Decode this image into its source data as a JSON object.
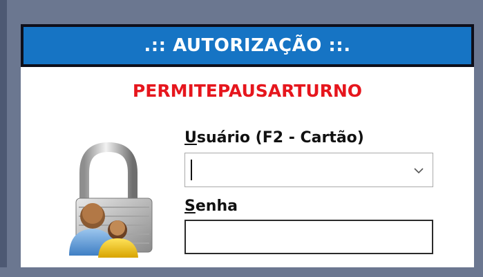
{
  "dialog": {
    "title": ".:: AUTORIZAÇÃO ::.",
    "permission": "PERMITEPAUSARTURNO",
    "user_field": {
      "label_underlined": "U",
      "label_rest": "suário (F2 - Cartão)",
      "value": ""
    },
    "password_field": {
      "label_underlined": "S",
      "label_rest": "enha",
      "value": ""
    }
  },
  "colors": {
    "title_bg": "#1674c4",
    "permission_text": "#e6161d",
    "backdrop": "#6b7790"
  },
  "icons": [
    "padlock-users-icon",
    "chevron-down-icon"
  ]
}
